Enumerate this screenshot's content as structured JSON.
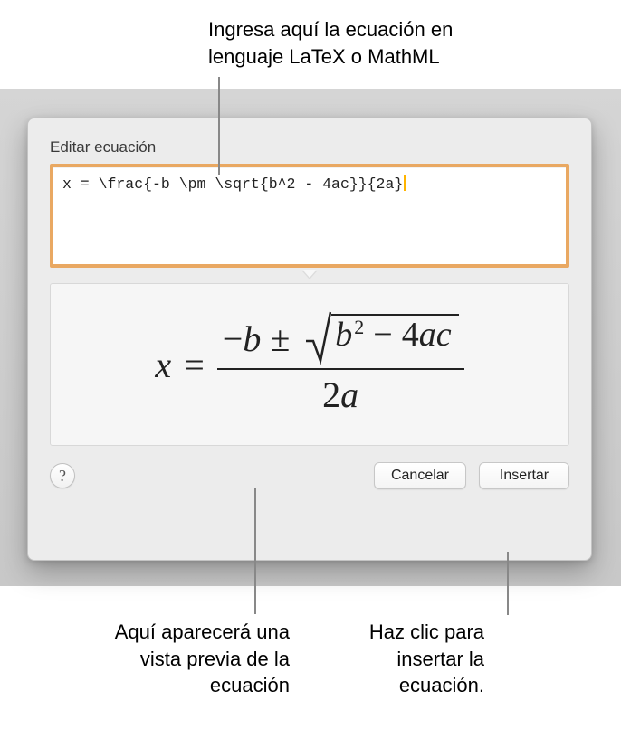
{
  "callouts": {
    "top": "Ingresa aquí la ecuación en\nlenguaje LaTeX o MathML",
    "bottom_left": "Aquí aparecerá una\nvista previa de la\necuación",
    "bottom_right": "Haz clic para\ninsertar la\necuación."
  },
  "dialog": {
    "title": "Editar ecuación",
    "latex_input": "x = \\frac{-b \\pm \\sqrt{b^2 - 4ac}}{2a}",
    "help_label": "?",
    "cancel_label": "Cancelar",
    "insert_label": "Insertar"
  },
  "preview": {
    "lhs": "x",
    "eq": "=",
    "minus": "−",
    "b": "b",
    "pm": "±",
    "rad_b": "b",
    "rad_exp": "2",
    "rad_minus": "−",
    "rad_four": "4",
    "rad_a": "a",
    "rad_c": "c",
    "den_two": "2",
    "den_a": "a"
  }
}
